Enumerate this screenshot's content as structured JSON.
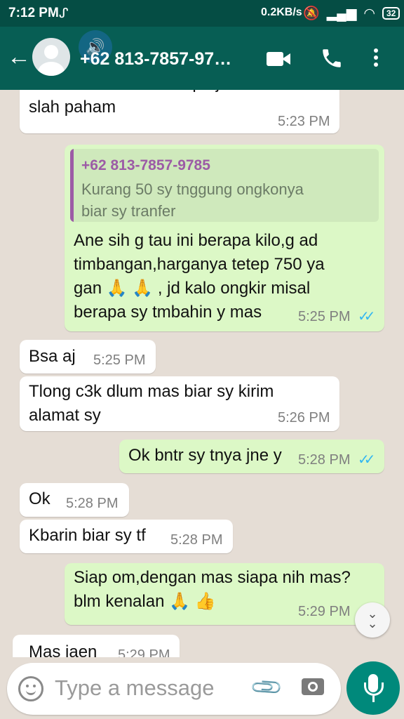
{
  "status": {
    "time": "7:12 PM",
    "net_speed": "0.2KB/s",
    "battery": "32"
  },
  "header": {
    "contact": "+62 813-7857-97…"
  },
  "messages": [
    {
      "text": "Kirom sswai alamat ktp aja biar nda\nslah paham",
      "time": "5:23 PM"
    },
    {
      "quote_name": "+62 813-7857-9785",
      "quote_text": "Kurang 50 sy tnggung ongkonya\nbiar sy tranfer",
      "text": "Ane sih g tau ini berapa kilo,g ad\ntimbangan,harganya tetep 750 ya\ngan 🙏 🙏 , jd kalo ongkir misal\nberapa sy tmbahin y mas",
      "time": "5:25 PM"
    },
    {
      "text": "Bsa aj",
      "time": "5:25 PM"
    },
    {
      "text": "Tlong c3k dlum mas biar sy kirim\nalamat sy",
      "time": "5:26 PM"
    },
    {
      "text": "Ok bntr sy tnya jne y",
      "time": "5:28 PM"
    },
    {
      "text": "Ok",
      "time": "5:28 PM"
    },
    {
      "text": "Kbarin biar sy tf",
      "time": "5:28 PM"
    },
    {
      "text": "Siap om,dengan mas siapa nih mas?\nblm kenalan 🙏 👍",
      "time": "5:29 PM"
    },
    {
      "text": "Mas jaen",
      "time": "5:29 PM"
    }
  ],
  "input": {
    "placeholder": "Type a message"
  },
  "colors": {
    "header": "#075e54",
    "statusbar": "#054d44",
    "outgoing": "#dcf8c6",
    "incoming": "#ffffff",
    "background": "#e5ddd5",
    "mic_button": "#00897b",
    "read_tick": "#34b7f1"
  },
  "icons": [
    "back-arrow-icon",
    "avatar-icon",
    "speaker-icon",
    "video-call-icon",
    "phone-icon",
    "more-options-icon",
    "read-ticks-icon",
    "scroll-down-icon",
    "emoji-icon",
    "attach-icon",
    "camera-icon",
    "mic-icon"
  ]
}
